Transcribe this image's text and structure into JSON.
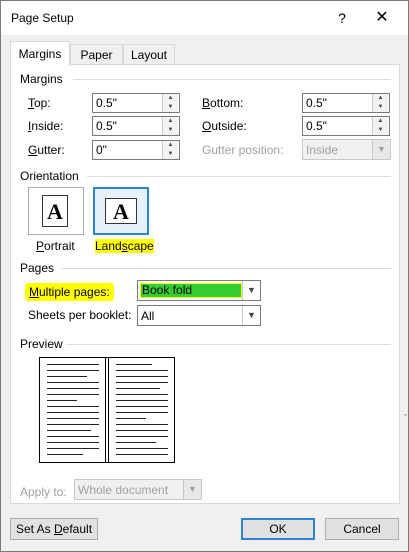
{
  "window": {
    "title": "Page Setup",
    "help_label": "?",
    "close_label": "✕"
  },
  "tabs": [
    {
      "label": "Margins",
      "active": true
    },
    {
      "label": "Paper",
      "active": false
    },
    {
      "label": "Layout",
      "active": false
    }
  ],
  "margins": {
    "section_label": "Margins",
    "top": {
      "label": "Top:",
      "value": "0.5\""
    },
    "inside": {
      "label": "Inside:",
      "value": "0.5\""
    },
    "gutter": {
      "label": "Gutter:",
      "value": "0\""
    },
    "bottom": {
      "label": "Bottom:",
      "value": "0.5\""
    },
    "outside": {
      "label": "Outside:",
      "value": "0.5\""
    },
    "gutter_position": {
      "label": "Gutter position:",
      "value": "Inside",
      "enabled": false
    }
  },
  "orientation": {
    "section_label": "Orientation",
    "portrait_label": "Portrait",
    "landscape_label": "Landscape",
    "icon_letter": "A",
    "selected": "landscape"
  },
  "pages": {
    "section_label": "Pages",
    "multiple_pages_label": "Multiple pages:",
    "multiple_pages_value": "Book fold",
    "sheets_label": "Sheets per booklet:",
    "sheets_value": "All"
  },
  "preview": {
    "section_label": "Preview"
  },
  "apply_to": {
    "label": "Apply to:",
    "value": "Whole document",
    "enabled": false
  },
  "buttons": {
    "set_default": "Set As Default",
    "ok": "OK",
    "cancel": "Cancel"
  },
  "colors": {
    "accent": "#2b84d6",
    "highlight": "#ffff00",
    "selected_fill": "#e5f1fb"
  }
}
